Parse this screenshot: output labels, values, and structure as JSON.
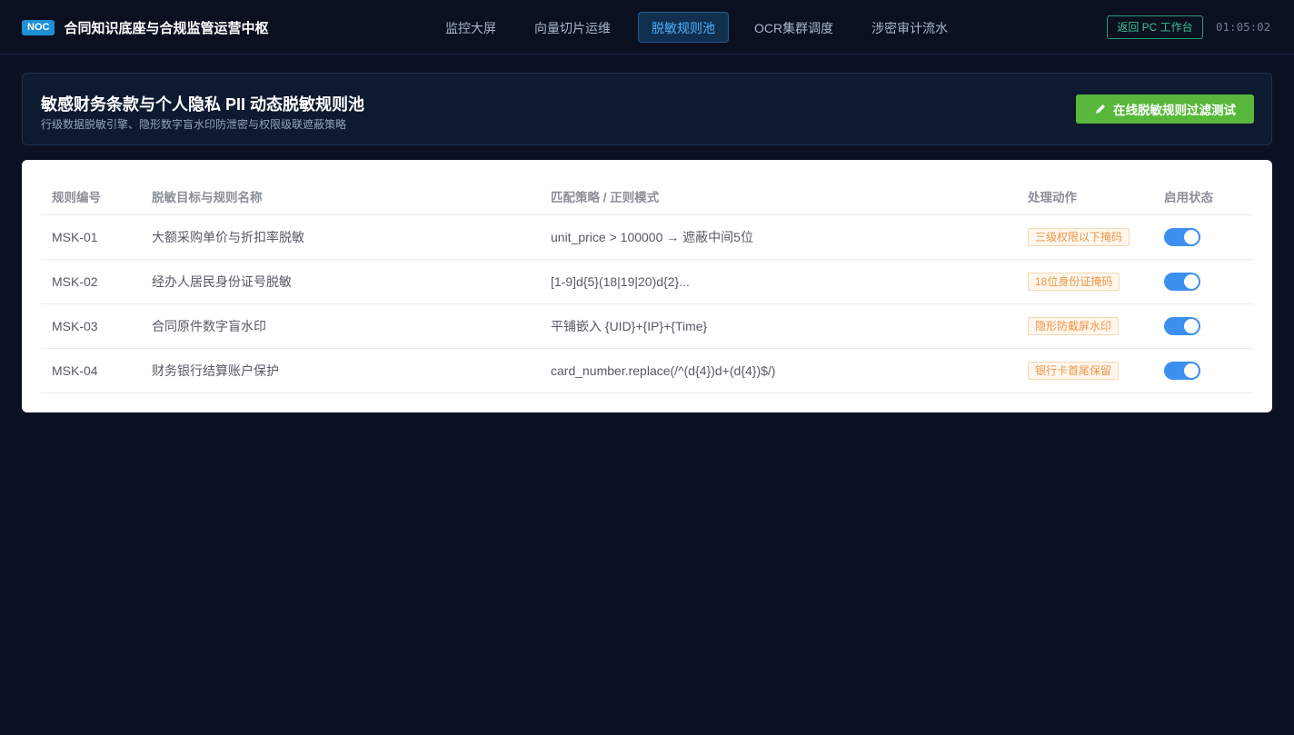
{
  "app": {
    "badge": "NOC",
    "title": "合同知识底座与合规监管运营中枢"
  },
  "nav": {
    "tabs": [
      {
        "label": "监控大屏",
        "active": false
      },
      {
        "label": "向量切片运维",
        "active": false
      },
      {
        "label": "脱敏规则池",
        "active": true
      },
      {
        "label": "OCR集群调度",
        "active": false
      },
      {
        "label": "涉密审计流水",
        "active": false
      }
    ]
  },
  "topbar": {
    "return_label": "返回 PC 工作台",
    "clock": "01:05:02"
  },
  "header": {
    "title": "敏感财务条款与个人隐私 PII 动态脱敏规则池",
    "subtitle": "行级数据脱敏引擎、隐形数字盲水印防泄密与权限级联遮蔽策略",
    "test_button_label": "在线脱敏规则过滤测试",
    "test_button_icon": "pencil-icon"
  },
  "table": {
    "columns": [
      "规则编号",
      "脱敏目标与规则名称",
      "匹配策略 / 正则模式",
      "处理动作",
      "启用状态"
    ],
    "rows": [
      {
        "id": "MSK-01",
        "name": "大额采购单价与折扣率脱敏",
        "pattern": "unit_price > 100000 → 遮蔽中间5位",
        "action": "三级权限以下掩码",
        "enabled": true
      },
      {
        "id": "MSK-02",
        "name": "经办人居民身份证号脱敏",
        "pattern": "[1-9]d{5}(18|19|20)d{2}...",
        "action": "18位身份证掩码",
        "enabled": true
      },
      {
        "id": "MSK-03",
        "name": "合同原件数字盲水印",
        "pattern": "平铺嵌入 {UID}+{IP}+{Time}",
        "action": "隐形防截屏水印",
        "enabled": true
      },
      {
        "id": "MSK-04",
        "name": "财务银行结算账户保护",
        "pattern": "card_number.replace(/^(d{4})d+(d{4})$/)",
        "action": "银行卡首尾保留",
        "enabled": true
      }
    ]
  },
  "colors": {
    "background": "#0b1122",
    "accent_blue": "#4ab1ff",
    "return_green": "#37c48f",
    "test_button_green": "#57b83c",
    "toggle_on": "#3d8ff0",
    "action_tag_orange": "#e9974a"
  }
}
